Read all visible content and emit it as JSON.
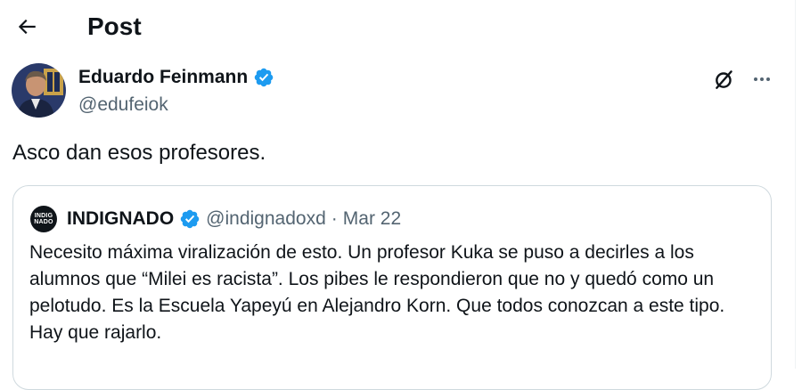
{
  "header": {
    "title": "Post"
  },
  "post": {
    "author": {
      "name": "Eduardo Feinmann",
      "handle": "@edufeiok",
      "verified": true
    },
    "text": "Asco dan esos profesores.",
    "quote": {
      "avatar_text": [
        "INDIG",
        "NADO"
      ],
      "name": "INDIGNADO",
      "handle": "@indignadoxd",
      "separator": "·",
      "date": "Mar 22",
      "text": "Necesito máxima viralización de esto. Un profesor Kuka se puso a decirles a los alumnos que “Milei es racista”. Los pibes le respondieron que no y quedó como un pelotudo. Es la Escuela Yapeyú en Alejandro Korn. Que todos conozcan a este tipo. Hay que rajarlo."
    }
  },
  "icons": {
    "back": "arrow-left-icon",
    "verified": "verified-badge-icon",
    "grok": "grok-icon",
    "more": "more-horizontal-icon"
  },
  "colors": {
    "verified_blue": "#1d9bf0",
    "text_primary": "#0f1419",
    "text_secondary": "#536471",
    "border": "#cfd9de"
  }
}
